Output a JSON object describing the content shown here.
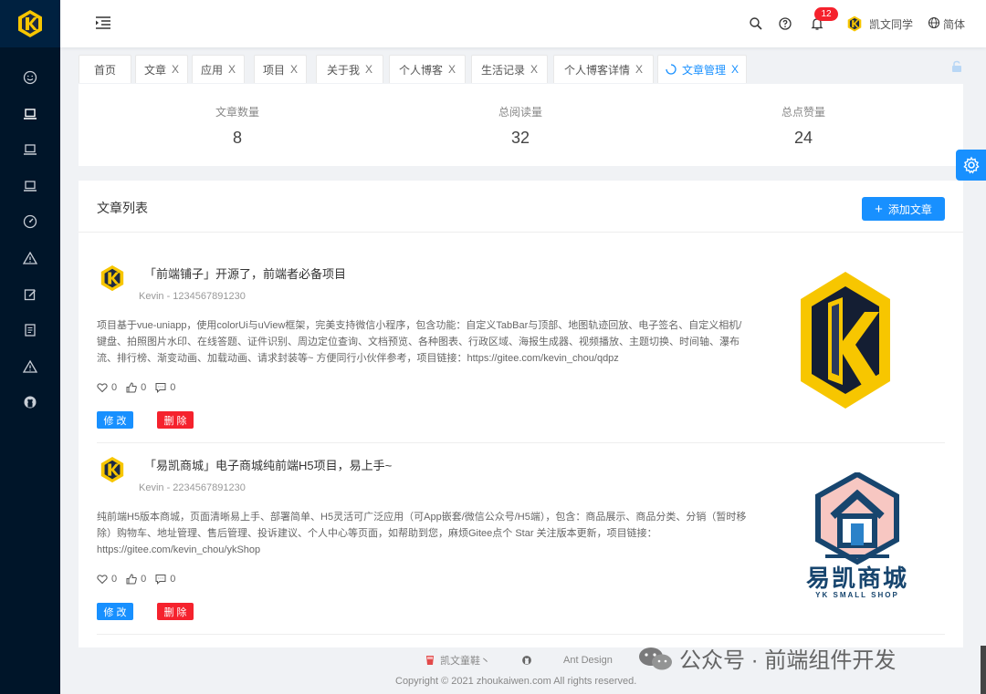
{
  "header": {
    "notifications_count": "12",
    "user_name": "凯文同学",
    "language": "简体"
  },
  "tabs": [
    {
      "label": "首页",
      "closable": false
    },
    {
      "label": "文章",
      "closable": true
    },
    {
      "label": "应用",
      "closable": true
    },
    {
      "label": "项目",
      "closable": true
    },
    {
      "label": "关于我",
      "closable": true
    },
    {
      "label": "个人博客",
      "closable": true
    },
    {
      "label": "生活记录",
      "closable": true
    },
    {
      "label": "个人博客详情",
      "closable": true
    },
    {
      "label": "文章管理",
      "closable": true,
      "active": true
    }
  ],
  "tab_close_glyph": "X",
  "stats": [
    {
      "label": "文章数量",
      "value": "8"
    },
    {
      "label": "总阅读量",
      "value": "32"
    },
    {
      "label": "总点赞量",
      "value": "24"
    }
  ],
  "list": {
    "title": "文章列表",
    "add_button": "添加文章",
    "edit_label": "修 改",
    "delete_label": "删 除",
    "items": [
      {
        "title": "「前端铺子」开源了，前端者必备项目",
        "meta": "Kevin - 1234567891230",
        "desc": "项目基于vue-uniapp，使用colorUi与uView框架，完美支持微信小程序，包含功能：自定义TabBar与顶部、地图轨迹回放、电子签名、自定义相机/键盘、拍照图片水印、在线答题、证件识别、周边定位查询、文档预览、各种图表、行政区域、海报生成器、视频播放、主题切换、时间轴、瀑布流、排行榜、渐变动画、加载动画、请求封装等~ 方便同行小伙伴参考，项目链接：https://gitee.com/kevin_chou/qdpz",
        "likes": "0",
        "thumbs": "0",
        "comments": "0"
      },
      {
        "title": "「易凯商城」电子商城纯前端H5项目，易上手~",
        "meta": "Kevin - 2234567891230",
        "desc": "纯前端H5版本商城，页面清晰易上手、部署简单、H5灵活可广泛应用（可App嵌套/微信公众号/H5端），包含：商品展示、商品分类、分销（暂时移除）购物车、地址管理、售后管理、投诉建议、个人中心等页面，如帮助到您，麻烦Gitee点个 Star 关注版本更新，项目链接：https://gitee.com/kevin_chou/ykShop",
        "likes": "0",
        "thumbs": "0",
        "comments": "0",
        "thumb_title": "易凯商城",
        "thumb_subtitle": "YK SMALL SHOP"
      }
    ]
  },
  "footer": {
    "link1": "凯文童鞋丶",
    "link2": "Ant Design",
    "copyright": "Copyright © 2021 zhoukaiwen.com All rights reserved."
  },
  "watermark": "公众号 · 前端组件开发",
  "colors": {
    "primary": "#1890ff",
    "danger": "#f5222d",
    "sidebar": "#001529",
    "logo_yellow": "#f7c600"
  }
}
